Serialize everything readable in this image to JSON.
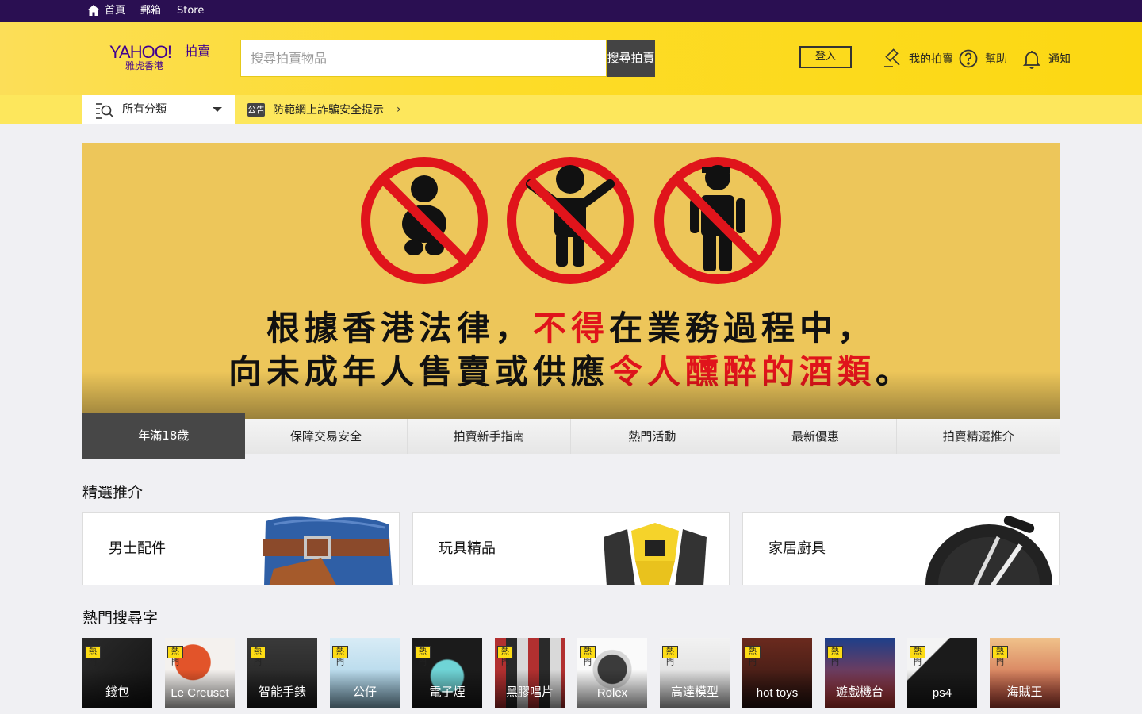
{
  "topbar": {
    "links": [
      {
        "label": "首頁",
        "icon": "home-icon"
      },
      {
        "label": "郵箱"
      },
      {
        "label": "Store"
      }
    ]
  },
  "header": {
    "logo": {
      "brand": "YAHOO!",
      "product": "拍賣",
      "region": "雅虎香港"
    },
    "search": {
      "placeholder": "搜尋拍賣物品",
      "button_label": "搜尋拍賣"
    },
    "login_label": "登入",
    "nav": [
      {
        "label": "我的拍賣",
        "icon": "gavel-icon"
      },
      {
        "label": "幫助",
        "icon": "help-icon"
      },
      {
        "label": "通知",
        "icon": "bell-icon"
      }
    ]
  },
  "subheader": {
    "category_label": "所有分類",
    "notice_tag": "公告",
    "notice_text": "防範網上詐騙安全提示"
  },
  "banner": {
    "line1_a": "根據香港法律，",
    "line1_red": "不得",
    "line1_b": "在業務過程中，",
    "line2_a": "向未成年人售賣或供應",
    "line2_red": "令人醺醉的酒類",
    "line2_b": "。"
  },
  "tabs": [
    "年滿18歲",
    "保障交易安全",
    "拍賣新手指南",
    "熱門活動",
    "最新優惠",
    "拍賣精選推介"
  ],
  "sections": {
    "featured_title": "精選推介",
    "hot_title": "熱門搜尋字"
  },
  "promos": [
    {
      "label": "男士配件",
      "image": "jeans-wallet-image"
    },
    {
      "label": "玩具精品",
      "image": "transformer-toy-image"
    },
    {
      "label": "家居廚具",
      "image": "skillet-image"
    }
  ],
  "hot_badge": "熱門",
  "hot_items": [
    {
      "label": "錢包",
      "image": "wallet-image"
    },
    {
      "label": "Le Creuset",
      "image": "cookware-image"
    },
    {
      "label": "智能手錶",
      "image": "smartwatch-image"
    },
    {
      "label": "公仔",
      "image": "plush-toy-image"
    },
    {
      "label": "電子煙",
      "image": "device-image"
    },
    {
      "label": "黑膠唱片",
      "image": "records-image"
    },
    {
      "label": "Rolex",
      "image": "rolex-image"
    },
    {
      "label": "高達模型",
      "image": "gundam-image"
    },
    {
      "label": "hot toys",
      "image": "hot-toys-image"
    },
    {
      "label": "遊戲機台",
      "image": "arcade-image"
    },
    {
      "label": "ps4",
      "image": "ps4-image"
    },
    {
      "label": "海賊王",
      "image": "one-piece-image"
    }
  ],
  "colors": {
    "topbar": "#2a0f52",
    "header_yellow": "#fddc2a",
    "subheader_yellow": "#fde75c",
    "brand_purple": "#400090",
    "banner_yellow": "#edc65a",
    "prohibit_red": "#e0141b"
  }
}
